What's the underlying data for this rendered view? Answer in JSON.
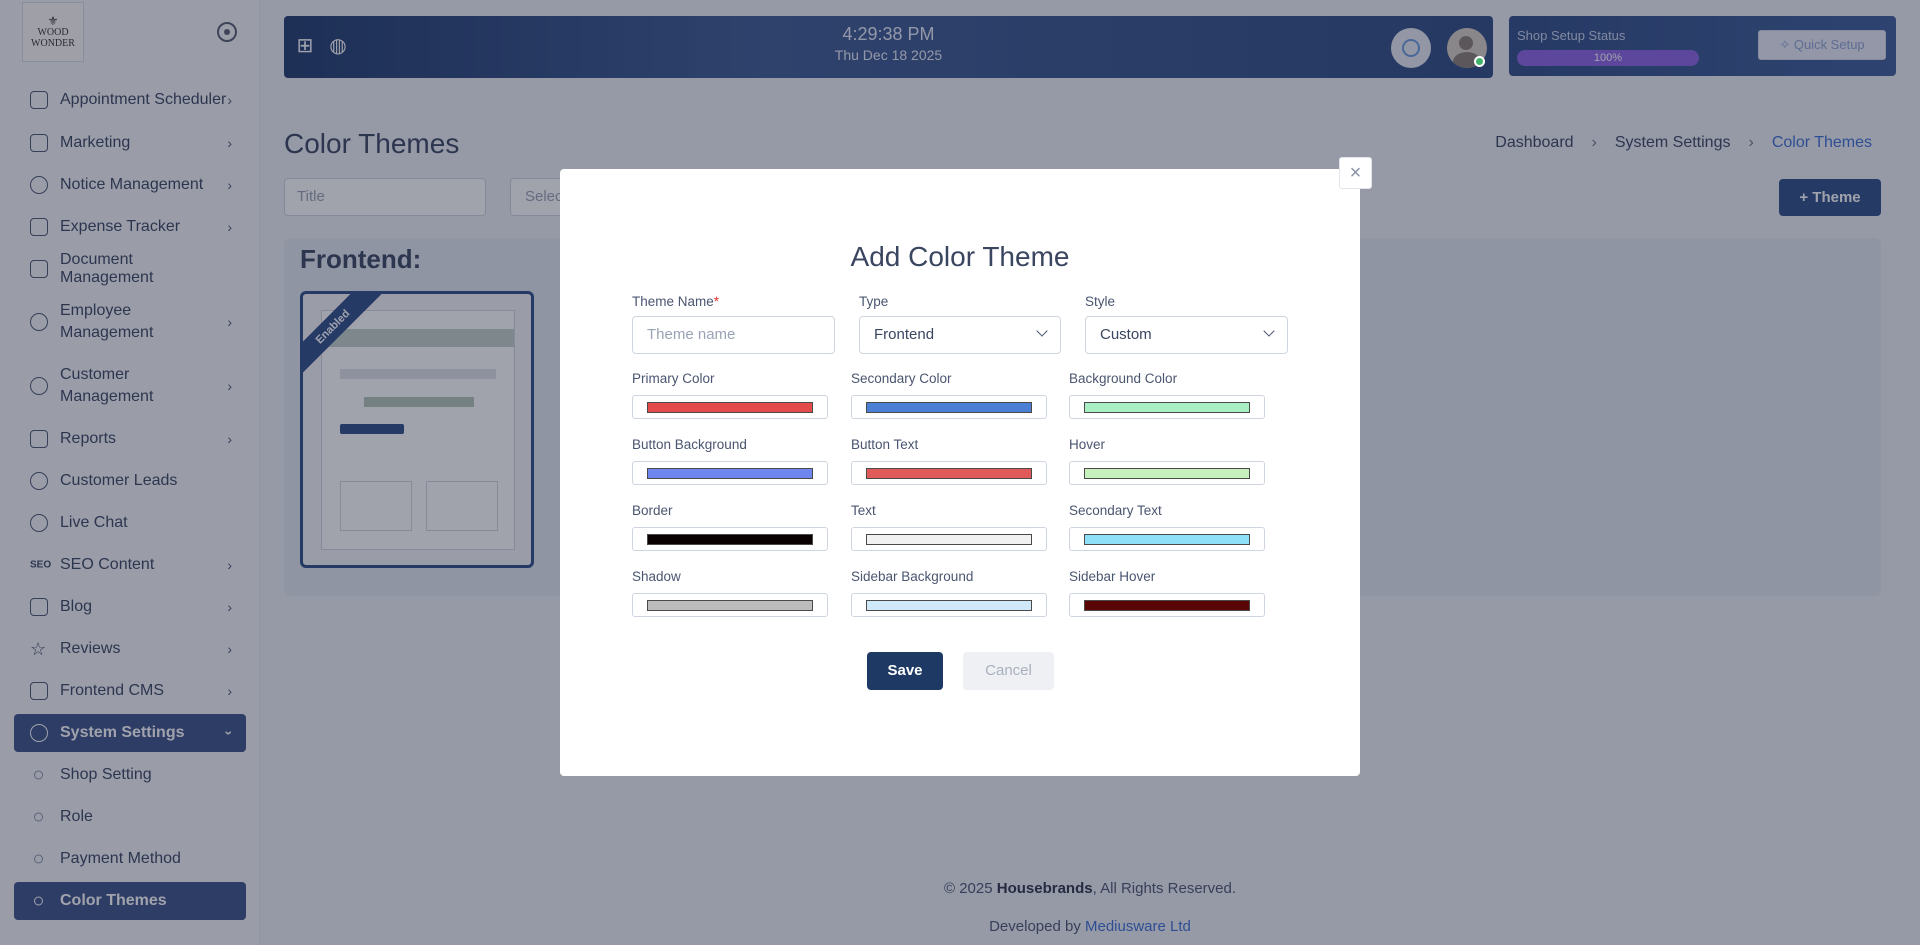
{
  "sidebar": {
    "logo_line1": "WOOD",
    "logo_line2": "WONDER",
    "items": [
      {
        "label": "Appointment Scheduler",
        "icon": "calendar-icon",
        "has_children": true
      },
      {
        "label": "Marketing",
        "icon": "marketing-icon",
        "has_children": true
      },
      {
        "label": "Notice Management",
        "icon": "bell-icon",
        "has_children": true
      },
      {
        "label": "Expense Tracker",
        "icon": "receipt-icon",
        "has_children": true
      },
      {
        "label": "Document Management",
        "icon": "document-icon",
        "has_children": false
      },
      {
        "label": "Employee Management",
        "icon": "users-icon",
        "has_children": true
      },
      {
        "label": "Customer Management",
        "icon": "users-icon",
        "has_children": true
      },
      {
        "label": "Reports",
        "icon": "report-icon",
        "has_children": true
      },
      {
        "label": "Customer Leads",
        "icon": "user-icon",
        "has_children": false
      },
      {
        "label": "Live Chat",
        "icon": "chat-icon",
        "has_children": false
      },
      {
        "label": "SEO Content",
        "icon": "seo-icon",
        "icon_text": "SEO",
        "has_children": true
      },
      {
        "label": "Blog",
        "icon": "blog-icon",
        "has_children": true
      },
      {
        "label": "Reviews",
        "icon": "star-icon",
        "has_children": true
      },
      {
        "label": "Frontend CMS",
        "icon": "sliders-icon",
        "has_children": true
      },
      {
        "label": "System Settings",
        "icon": "gear-icon",
        "has_children": true,
        "expanded": true,
        "active": true
      }
    ],
    "sub_items": [
      {
        "label": "Shop Setting"
      },
      {
        "label": "Role"
      },
      {
        "label": "Payment Method"
      },
      {
        "label": "Color Themes",
        "active": true
      }
    ]
  },
  "header": {
    "time": "4:29:38 PM",
    "date": "Thu Dec 18 2025",
    "icons": [
      "add-widget-icon",
      "globe-icon",
      "timer-icon",
      "avatar"
    ]
  },
  "setup": {
    "label": "Shop Setup Status",
    "progress_text": "100%",
    "progress": 1.0,
    "quick_setup": "Quick Setup"
  },
  "page": {
    "title": "Color Themes",
    "breadcrumb": [
      "Dashboard",
      "System Settings",
      "Color Themes"
    ],
    "filter_title_placeholder": "Title",
    "filter_select_placeholder": "Selec",
    "add_button": "+ Theme",
    "section_title": "Frontend:",
    "card_badge": "Enabled"
  },
  "footer": {
    "copyright_prefix": "© 2025 ",
    "brand": "Housebrands",
    "copyright_suffix": ", All Rights Reserved.",
    "developed_by": "Developed by ",
    "developer": "Mediusware Ltd"
  },
  "modal": {
    "title": "Add Color Theme",
    "close": "×",
    "theme_name_label": "Theme Name",
    "theme_name_required": "*",
    "theme_name_placeholder": "Theme name",
    "type_label": "Type",
    "type_value": "Frontend",
    "style_label": "Style",
    "style_value": "Custom",
    "colors": [
      {
        "label": "Primary Color",
        "color": "#e34a4a"
      },
      {
        "label": "Secondary Color",
        "color": "#4a7fd4"
      },
      {
        "label": "Background Color",
        "color": "#a8f0c4"
      },
      {
        "label": "Button Background",
        "color": "#6f86ee"
      },
      {
        "label": "Button Text",
        "color": "#e05a5a"
      },
      {
        "label": "Hover",
        "color": "#c7f0bf"
      },
      {
        "label": "Border",
        "color": "#0a0202"
      },
      {
        "label": "Text",
        "color": "#f1f1f1"
      },
      {
        "label": "Secondary Text",
        "color": "#8ee0f8"
      },
      {
        "label": "Shadow",
        "color": "#bcbcbc"
      },
      {
        "label": "Sidebar Background",
        "color": "#cfe9fb"
      },
      {
        "label": "Sidebar Hover",
        "color": "#5a0606"
      }
    ],
    "save": "Save",
    "cancel": "Cancel"
  }
}
